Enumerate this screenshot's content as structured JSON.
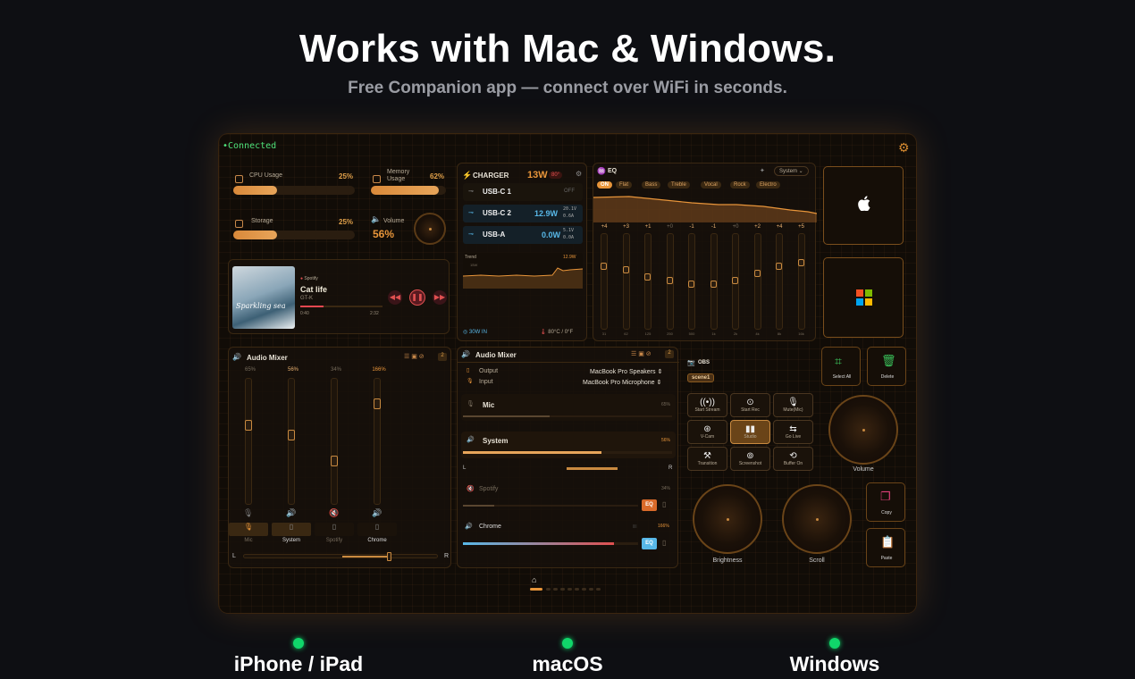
{
  "hero": {
    "title": "Works with Mac & Windows.",
    "subtitle": "Free Companion app — connect over WiFi in seconds."
  },
  "status": {
    "connected": "•Connected"
  },
  "system": {
    "cpu_label": "CPU Usage",
    "cpu_pct": "25%",
    "memory_label": "Memory Usage",
    "memory_pct": "62%",
    "storage_label": "Storage",
    "storage_pct": "25%",
    "volume_label": "Volume",
    "volume_pct": "56%",
    "cpu_level": 0.25,
    "memory_level": 0.62,
    "storage_level": 0.25
  },
  "media": {
    "source": "Spotify",
    "title": "Cat life",
    "artist": "GT-K",
    "elapsed": "0:40",
    "duration": "2:32",
    "art_caption": "Sparkling sea",
    "progress": 0.28
  },
  "charger": {
    "title": "CHARGER",
    "watts": "13W",
    "temp_badge": "80°",
    "ports": [
      {
        "name": "USB-C 1",
        "power": "",
        "status": "OFF",
        "detail1": "",
        "detail2": ""
      },
      {
        "name": "USB-C 2",
        "power": "12.9W",
        "status": "",
        "detail1": "20.1V",
        "detail2": "0.6A"
      },
      {
        "name": "USB-A",
        "power": "0.0W",
        "status": "",
        "detail1": "5.1V",
        "detail2": "0.0A"
      }
    ],
    "trend_label": "Trend",
    "trend_value": "12.9W",
    "trend_axis": "15W",
    "input": "30W IN",
    "temp": "80°C / 0°F"
  },
  "eq": {
    "title": "EQ",
    "output": "System",
    "presets": [
      "ON",
      "Flat",
      "Bass",
      "Treble",
      "Vocal",
      "Rock",
      "Electro"
    ],
    "gains": [
      "+4",
      "+3",
      "+1",
      "+0",
      "-1",
      "-1",
      "+0",
      "+2",
      "+4",
      "+5"
    ],
    "bands": [
      "31",
      "62",
      "125",
      "250",
      "500",
      "1k",
      "2k",
      "4k",
      "8k",
      "16k"
    ],
    "gain_values": [
      4,
      3,
      1,
      0,
      -1,
      -1,
      0,
      2,
      4,
      5
    ]
  },
  "shortcuts": {
    "apple_icon": "apple-logo",
    "windows_icon": "windows-logo"
  },
  "mixer_left": {
    "title": "Audio Mixer",
    "badge": "2",
    "channels": [
      {
        "name": "Mic",
        "pct": "65%",
        "level": 0.65
      },
      {
        "name": "System",
        "pct": "56%",
        "level": 0.56
      },
      {
        "name": "Spotify",
        "pct": "34%",
        "level": 0.34
      },
      {
        "name": "Chrome",
        "pct": "166%",
        "level": 0.83
      }
    ],
    "left": "L",
    "right": "R"
  },
  "mixer_right": {
    "title": "Audio Mixer",
    "badge": "2",
    "output_label": "Output",
    "output_value": "MacBook Pro Speakers",
    "input_label": "Input",
    "input_value": "MacBook Pro Microphone",
    "mic_name": "Mic",
    "mic_pct": "65%",
    "system_name": "System",
    "system_pct": "56%",
    "left": "L",
    "right": "R",
    "spotify_name": "Spotify",
    "spotify_pct": "34%",
    "chrome_name": "Chrome",
    "chrome_pct": "166%",
    "eq_label": "EQ",
    "mic_level": 0.65,
    "system_level": 0.56,
    "spotify_level": 0.34,
    "chrome_level": 0.83
  },
  "obs": {
    "title": "OBS",
    "scene": "scene1",
    "buttons": [
      "Start Stream",
      "Start Rec",
      "Mute(Mic)",
      "V-Cam",
      "Studio",
      "Go Live",
      "Transition",
      "Screenshot",
      "Buffer On"
    ]
  },
  "actions": {
    "select_all": "Select All",
    "delete": "Delete",
    "volume": "Volume",
    "brightness": "Brightness",
    "scroll": "Scroll",
    "copy": "Copy",
    "paste": "Paste"
  },
  "platforms": [
    "iPhone / iPad",
    "macOS",
    "Windows"
  ],
  "colors": {
    "accent": "#e8953a",
    "blue": "#58b8e8",
    "online": "#10d66a",
    "background": "#0e0f13"
  }
}
